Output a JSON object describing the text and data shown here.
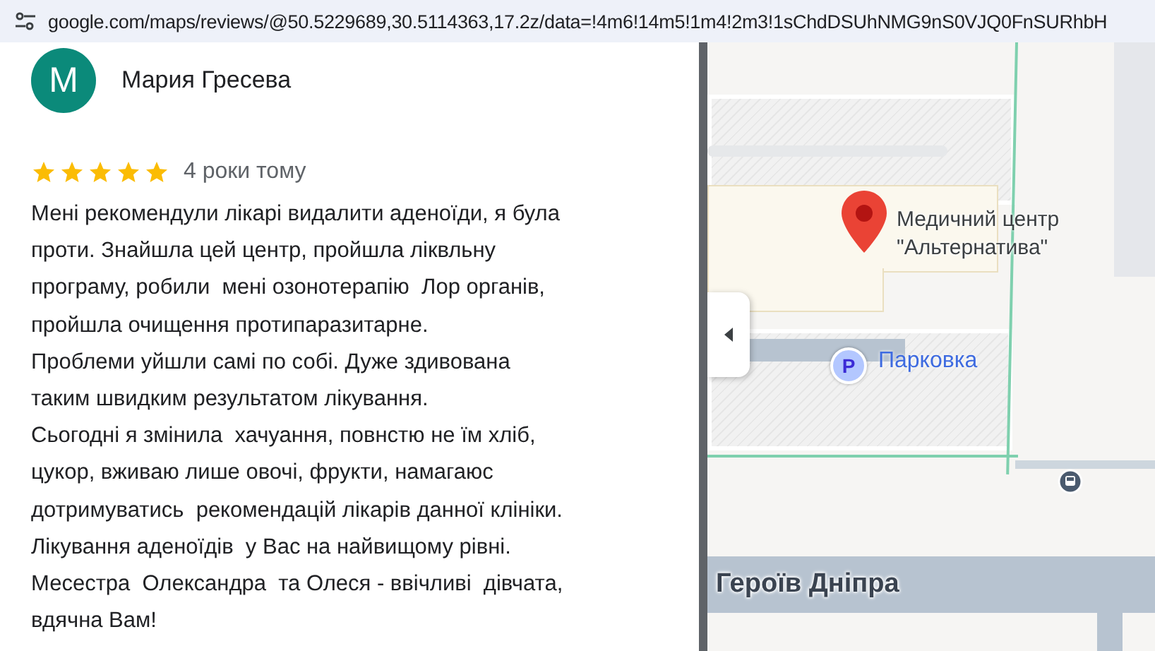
{
  "address_bar": {
    "url": "google.com/maps/reviews/@50.5229689,30.5114363,17.2z/data=!4m6!14m5!1m4!2m3!1sChdDSUhNMG9nS0VJQ0FnSURhbH"
  },
  "review": {
    "avatar_letter": "М",
    "author": "Мария Гресева",
    "stars": 5,
    "time": "4 роки тому",
    "text": "Мені рекомендули лікарі видалити аденоїди, я була\nпроти. Знайшла цей центр, пройшла ліквльну\nпрограму, робили  мені озонотерапію  Лор органів,\nпройшла очищення протипаразитарне.\nПроблеми уйшли самі по собі. Дуже здивована\nтаким швидким результатом лікування.\nСьогодні я змінила  хачуання, повнстю не їм хліб,\nцукор, вживаю лише овочі, фрукти, намагаюс\nдотримуватись  рекомендацій лікарів данної клініки.\nЛікування аденоїдів  у Вас на найвищому рівні.\nМесестра  Олександра  та Олеся - ввічливі  дівчата,\nвдячна Вам!"
  },
  "map": {
    "place_label": "Медичний центр\n\"Альтернатива\"",
    "parking_badge": "P",
    "parking_label": "Парковка",
    "street_label": "Героїв Дніпра"
  }
}
